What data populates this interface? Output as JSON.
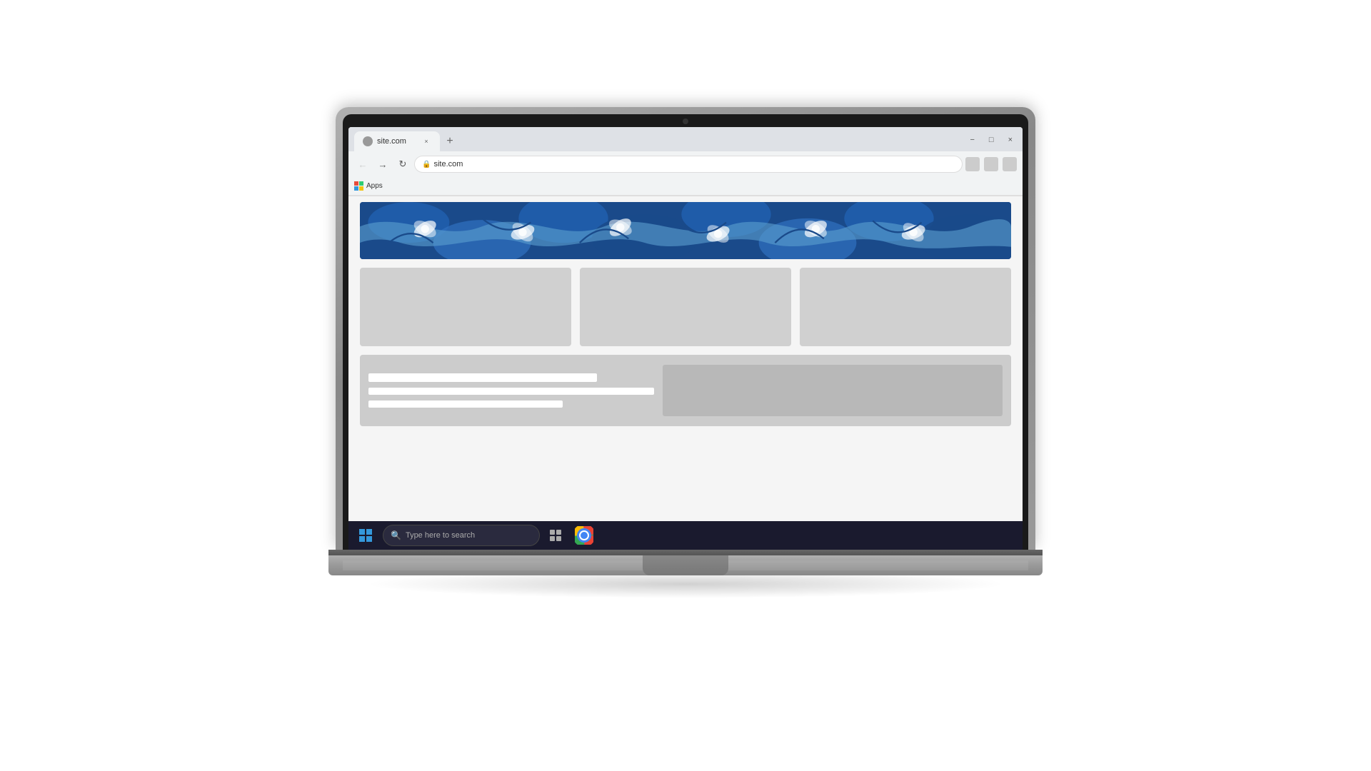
{
  "browser": {
    "tab_label": "site.com",
    "tab_close": "×",
    "tab_new": "+",
    "win_minimize": "−",
    "win_maximize": "□",
    "win_close": "×",
    "address": "site.com",
    "nav_back": "←",
    "nav_forward": "→",
    "nav_refresh": "↻"
  },
  "bookmarks": {
    "apps_label": "Apps"
  },
  "taskbar": {
    "search_placeholder": "Type here to search",
    "win_start_label": "Start"
  },
  "colors": {
    "banner_dark_blue": "#1a4a8a",
    "banner_mid_blue": "#2060b0",
    "banner_light_blue": "#5ba0d0",
    "win_red": "#e74c3c",
    "win_green": "#2ecc71",
    "win_blue": "#3498db",
    "win_yellow": "#f1c40f",
    "taskbar_bg": "#1a1a2e"
  }
}
